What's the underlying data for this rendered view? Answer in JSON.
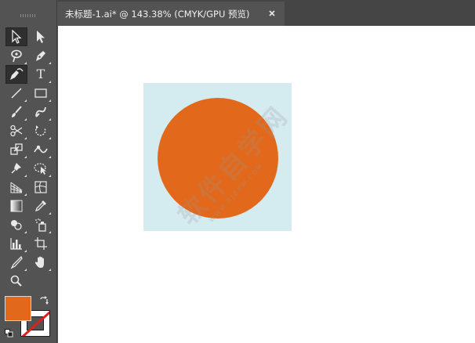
{
  "document_tab": {
    "title": "未标题-1.ai* @ 143.38% (CMYK/GPU 预览)"
  },
  "toolbar": {
    "type_tool_glyph": "T",
    "tools": [
      {
        "name": "selection-tool",
        "icon": "selection-arrow-icon",
        "active": true
      },
      {
        "name": "direct-selection-tool",
        "icon": "direct-selection-arrow-icon"
      },
      {
        "name": "magic-wand-tool",
        "icon": "magic-wand-icon"
      },
      {
        "name": "pen-tool",
        "icon": "pen-icon"
      },
      {
        "name": "curvature-tool",
        "icon": "curvature-pen-icon",
        "active": true
      },
      {
        "name": "type-tool",
        "icon": "type-icon"
      },
      {
        "name": "line-tool",
        "icon": "line-segment-icon"
      },
      {
        "name": "rectangle-tool",
        "icon": "rectangle-icon"
      },
      {
        "name": "paintbrush-tool",
        "icon": "paintbrush-icon"
      },
      {
        "name": "shaper-tool",
        "icon": "shaper-icon"
      },
      {
        "name": "scissors-tool",
        "icon": "scissors-icon"
      },
      {
        "name": "rotate-tool",
        "icon": "rotate-icon"
      },
      {
        "name": "scale-tool",
        "icon": "scale-icon"
      },
      {
        "name": "warp-tool",
        "icon": "warp-icon"
      },
      {
        "name": "puppet-warp-tool",
        "icon": "pushpin-icon"
      },
      {
        "name": "free-transform-tool",
        "icon": "free-transform-icon"
      },
      {
        "name": "perspective-grid-tool",
        "icon": "perspective-grid-icon"
      },
      {
        "name": "mesh-tool",
        "icon": "mesh-icon"
      },
      {
        "name": "gradient-tool",
        "icon": "gradient-icon"
      },
      {
        "name": "eyedropper-tool",
        "icon": "eyedropper-icon"
      },
      {
        "name": "shape-builder-tool",
        "icon": "shape-builder-icon"
      },
      {
        "name": "symbol-sprayer-tool",
        "icon": "symbol-sprayer-icon"
      },
      {
        "name": "column-graph-tool",
        "icon": "column-graph-icon"
      },
      {
        "name": "artboard-tool",
        "icon": "artboard-icon"
      },
      {
        "name": "slice-tool",
        "icon": "slice-knife-icon"
      },
      {
        "name": "hand-tool",
        "icon": "hand-icon"
      },
      {
        "name": "zoom-tool",
        "icon": "magnifier-icon"
      }
    ]
  },
  "fill_stroke": {
    "fill_color": "#e2691c",
    "stroke": "none"
  },
  "canvas": {
    "background_color": "#ffffff",
    "rect_color": "#d4ebf0",
    "circle_color": "#e2691c",
    "watermark_text": "软件自学网",
    "watermark_sub": "WWW.RJZXW.COM"
  }
}
